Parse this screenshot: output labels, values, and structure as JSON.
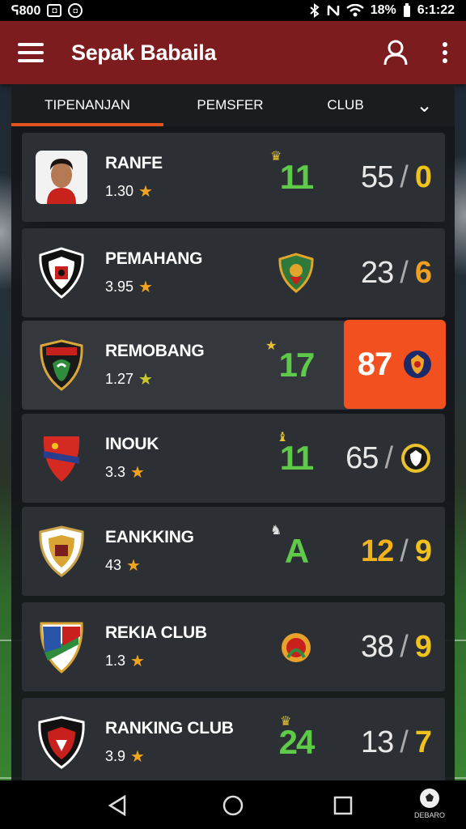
{
  "status_bar": {
    "left_text": "ᕋ800",
    "box_glyph": "◘",
    "circle_glyph": "◘",
    "battery": "18%",
    "time": "6:1:22",
    "icons": [
      "bluetooth-icon",
      "nfc-icon",
      "wifi-icon"
    ]
  },
  "app_bar": {
    "title": "Sepak Babaila",
    "icons": [
      "menu-icon",
      "profile-icon",
      "more-vert-icon"
    ]
  },
  "tabs": [
    {
      "label": "TIPENANJAN",
      "active": true
    },
    {
      "label": "PEMSFER",
      "active": false
    },
    {
      "label": "CLUB",
      "active": false
    },
    {
      "label": "⌄",
      "active": false
    }
  ],
  "clubs": [
    {
      "name": "RANFE",
      "rating": "1.30",
      "mid": "11",
      "score": "55",
      "side": "0",
      "logo": "player-photo",
      "highlighted": false
    },
    {
      "name": "PEMAHANG",
      "rating": "3.95",
      "mid": "",
      "score": "23",
      "side": "6",
      "logo": "crest-black-red",
      "highlighted": false
    },
    {
      "name": "REMOBANG",
      "rating": "1.27",
      "mid": "17",
      "score": "87",
      "side": "",
      "logo": "crest-green-dark",
      "highlighted": true
    },
    {
      "name": "INOUK",
      "rating": "3.3",
      "mid": "11",
      "score": "65",
      "side": "",
      "logo": "crest-red-blue",
      "highlighted": false
    },
    {
      "name": "EANKKING",
      "rating": "43",
      "mid": "A",
      "score": "12",
      "side": "9",
      "logo": "crest-gold",
      "highlighted": false
    },
    {
      "name": "REKIA CLUB",
      "rating": "1.3",
      "mid": "",
      "score": "38",
      "side": "9",
      "logo": "crest-tricolor",
      "highlighted": false
    },
    {
      "name": "RANKING CLUB",
      "rating": "3.9",
      "mid": "24",
      "score": "13",
      "side": "7",
      "logo": "crest-red-black",
      "highlighted": false
    }
  ],
  "nav_bar": {
    "corner_label": "DEBARO",
    "icons": [
      "back-icon",
      "home-icon",
      "recents-icon"
    ]
  },
  "colors": {
    "app_bar": "#7d1c1e",
    "accent": "#e2521c",
    "highlight": "#f2501e",
    "star": "#f1a51e",
    "mid_number": "#5fc94a",
    "side_number": "#f1c21b"
  }
}
